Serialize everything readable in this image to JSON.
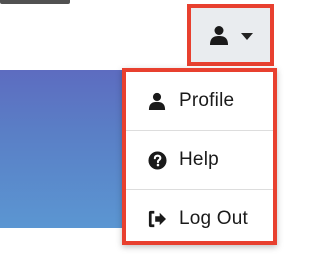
{
  "user_menu": {
    "toggle_icon": "user-icon",
    "caret_icon": "caret-down-icon",
    "highlight_color": "#e8402f",
    "toggle_background": "#e9ecef"
  },
  "dropdown": {
    "items": [
      {
        "label": "Profile",
        "icon": "user-icon"
      },
      {
        "label": "Help",
        "icon": "question-circle-icon"
      },
      {
        "label": "Log Out",
        "icon": "sign-out-icon"
      }
    ]
  },
  "banner": {
    "gradient_start": "#5d6cc0",
    "gradient_end": "#5b96d2"
  }
}
